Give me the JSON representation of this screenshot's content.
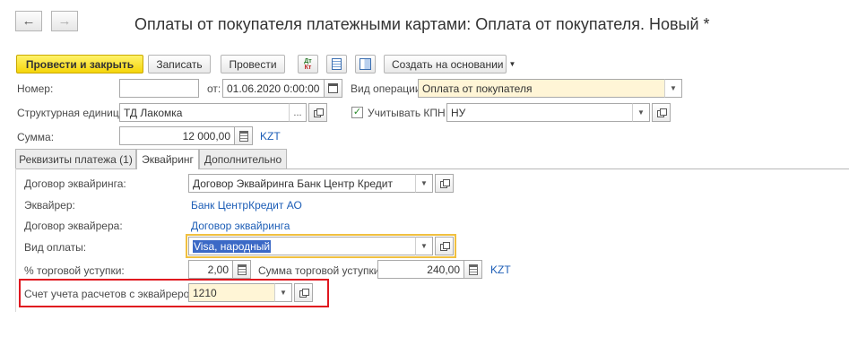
{
  "nav": {
    "back_icon": "arrow-left-icon",
    "forward_icon": "arrow-right-icon"
  },
  "window": {
    "title": "Оплаты от покупателя платежными картами: Оплата от покупателя. Новый *"
  },
  "toolbar": {
    "post_and_close": "Провести и закрыть",
    "save": "Записать",
    "post": "Провести",
    "dt_kt_glyph": "Дт Кт",
    "create_based_on": "Создать на основании"
  },
  "header": {
    "number_label": "Номер:",
    "number_value": "",
    "date_label": "от:",
    "date_value": "01.06.2020  0:00:00",
    "operation_label": "Вид операции:",
    "operation_value": "Оплата от покупателя",
    "unit_label": "Структурная единица:",
    "unit_value": "ТД Лакомка",
    "kpn_label": "Учитывать КПН",
    "kpn_checked": true,
    "kpn_value": "НУ",
    "sum_label": "Сумма:",
    "sum_value": "12 000,00",
    "currency": "KZT"
  },
  "tabs": [
    {
      "label": "Реквизиты платежа (1)",
      "active": false
    },
    {
      "label": "Эквайринг",
      "active": true
    },
    {
      "label": "Дополнительно",
      "active": false
    }
  ],
  "acquiring": {
    "contract_label": "Договор эквайринга:",
    "contract_value": "Договор Эквайринга Банк Центр Кредит",
    "acquirer_label": "Эквайрер:",
    "acquirer_value": "Банк ЦентрКредит АО",
    "acquirer_contract_label": "Договор эквайрера:",
    "acquirer_contract_value": "Договор эквайринга",
    "payment_type_label": "Вид оплаты:",
    "payment_type_value": "Visa, народный",
    "discount_label": "% торговой уступки:",
    "discount_value": "2,00",
    "discount_sum_label": "Сумма торговой уступки:",
    "discount_sum_value": "240,00",
    "discount_sum_currency": "KZT",
    "account_label": "Счет учета расчетов с эквайрером:",
    "account_value": "1210"
  },
  "colors": {
    "primary_button": "#f5d50a",
    "highlight_border": "#e0171f",
    "link": "#1c5db6",
    "focus_border": "#f0c040"
  }
}
